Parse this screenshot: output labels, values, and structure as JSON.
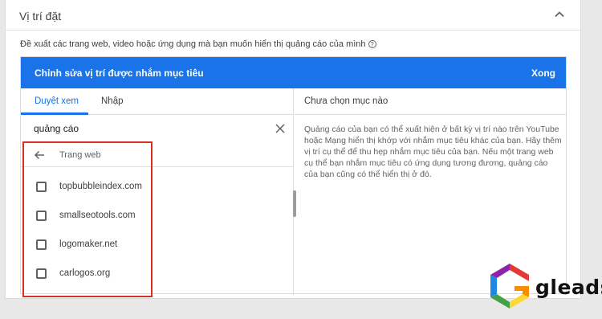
{
  "section": {
    "title": "Vị trí đặt",
    "description": "Đề xuất các trang web, video hoặc ứng dụng mà bạn muốn hiển thị quảng cáo của mình"
  },
  "editor": {
    "title": "Chỉnh sửa vị trí được nhắm mục tiêu",
    "done_label": "Xong",
    "tabs": [
      {
        "label": "Duyệt xem",
        "active": true
      },
      {
        "label": "Nhập",
        "active": false
      }
    ],
    "search": {
      "value": "quảng cáo"
    },
    "back_label": "Trang web",
    "sites": [
      {
        "label": "topbubbleindex.com",
        "checked": false
      },
      {
        "label": "smallseotools.com",
        "checked": false
      },
      {
        "label": "logomaker.net",
        "checked": false
      },
      {
        "label": "carlogos.org",
        "checked": false
      }
    ],
    "right_panel": {
      "title": "Chưa chọn mục nào",
      "body": "Quảng cáo của bạn có thể xuất hiện ở bất kỳ vị trí nào trên YouTube hoặc Mạng hiển thị khớp với nhắm mục tiêu khác của bạn. Hãy thêm vị trí cụ thể để thu hẹp nhắm mục tiêu của bạn. Nếu một trang web cụ thể bạn nhắm mục tiêu có ứng dụng tương đương, quảng cáo của bạn cũng có thể hiển thị ở đó."
    }
  },
  "brand": {
    "logo_text": "gleads"
  },
  "colors": {
    "primary": "#1a73e8",
    "highlight": "#d93025"
  },
  "icons": [
    "chevron-up-icon",
    "help-icon",
    "close-icon",
    "arrow-back-icon",
    "checkbox-icon",
    "gleads-logo-icon"
  ]
}
